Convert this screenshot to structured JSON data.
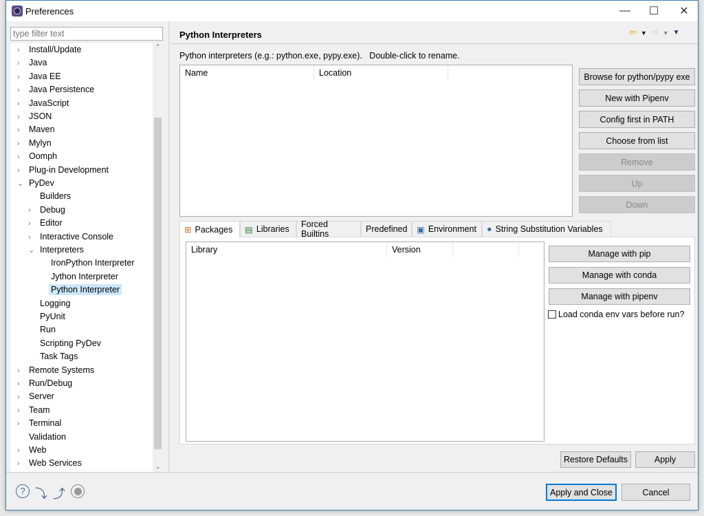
{
  "window": {
    "title": "Preferences",
    "minimize": "—",
    "maximize": "☐",
    "close": "✕"
  },
  "filter": {
    "placeholder": "type filter text"
  },
  "tree": [
    {
      "label": "Install/Update",
      "level": 0,
      "chev": "›"
    },
    {
      "label": "Java",
      "level": 0,
      "chev": "›"
    },
    {
      "label": "Java EE",
      "level": 0,
      "chev": "›"
    },
    {
      "label": "Java Persistence",
      "level": 0,
      "chev": "›"
    },
    {
      "label": "JavaScript",
      "level": 0,
      "chev": "›"
    },
    {
      "label": "JSON",
      "level": 0,
      "chev": "›"
    },
    {
      "label": "Maven",
      "level": 0,
      "chev": "›"
    },
    {
      "label": "Mylyn",
      "level": 0,
      "chev": "›"
    },
    {
      "label": "Oomph",
      "level": 0,
      "chev": "›"
    },
    {
      "label": "Plug-in Development",
      "level": 0,
      "chev": "›"
    },
    {
      "label": "PyDev",
      "level": 0,
      "chev": "⌄"
    },
    {
      "label": "Builders",
      "level": 1,
      "chev": ""
    },
    {
      "label": "Debug",
      "level": 1,
      "chev": "›"
    },
    {
      "label": "Editor",
      "level": 1,
      "chev": "›"
    },
    {
      "label": "Interactive Console",
      "level": 1,
      "chev": "›"
    },
    {
      "label": "Interpreters",
      "level": 1,
      "chev": "⌄"
    },
    {
      "label": "IronPython Interpreter",
      "level": 2,
      "chev": ""
    },
    {
      "label": "Jython Interpreter",
      "level": 2,
      "chev": ""
    },
    {
      "label": "Python Interpreter",
      "level": 2,
      "chev": "",
      "selected": true
    },
    {
      "label": "Logging",
      "level": 1,
      "chev": ""
    },
    {
      "label": "PyUnit",
      "level": 1,
      "chev": ""
    },
    {
      "label": "Run",
      "level": 1,
      "chev": ""
    },
    {
      "label": "Scripting PyDev",
      "level": 1,
      "chev": ""
    },
    {
      "label": "Task Tags",
      "level": 1,
      "chev": ""
    },
    {
      "label": "Remote Systems",
      "level": 0,
      "chev": "›"
    },
    {
      "label": "Run/Debug",
      "level": 0,
      "chev": "›"
    },
    {
      "label": "Server",
      "level": 0,
      "chev": "›"
    },
    {
      "label": "Team",
      "level": 0,
      "chev": "›"
    },
    {
      "label": "Terminal",
      "level": 0,
      "chev": "›"
    },
    {
      "label": "Validation",
      "level": 0,
      "chev": ""
    },
    {
      "label": "Web",
      "level": 0,
      "chev": "›"
    },
    {
      "label": "Web Services",
      "level": 0,
      "chev": "›"
    }
  ],
  "page": {
    "title": "Python Interpreters",
    "description": "Python interpreters (e.g.: python.exe, pypy.exe).   Double-click to rename.",
    "columns": [
      "Name",
      "Location"
    ],
    "buttons": [
      {
        "label": "Browse for python/pypy exe",
        "enabled": true
      },
      {
        "label": "New with Pipenv",
        "enabled": true
      },
      {
        "label": "Config first in PATH",
        "enabled": true
      },
      {
        "label": "Choose from list",
        "enabled": true
      },
      {
        "label": "Remove",
        "enabled": false
      },
      {
        "label": "Up",
        "enabled": false
      },
      {
        "label": "Down",
        "enabled": false
      }
    ],
    "tabs": [
      {
        "label": "Packages",
        "icon": "packages-icon",
        "selected": true
      },
      {
        "label": "Libraries",
        "icon": "libraries-icon"
      },
      {
        "label": "Forced Builtins"
      },
      {
        "label": "Predefined"
      },
      {
        "label": "Environment",
        "icon": "environment-icon"
      },
      {
        "label": "String Substitution Variables",
        "icon": "variables-icon"
      }
    ],
    "pkg_columns": [
      "Library",
      "Version"
    ],
    "pkg_buttons": [
      "Manage with pip",
      "Manage with conda",
      "Manage with pipenv"
    ],
    "conda_checkbox": {
      "label": "Load conda env vars before run?",
      "checked": false
    },
    "restore_defaults": "Restore Defaults",
    "apply": "Apply"
  },
  "footer": {
    "apply_close": "Apply and Close",
    "cancel": "Cancel"
  },
  "colors": {
    "selection": "#cce8ff",
    "accent": "#0078d7"
  }
}
